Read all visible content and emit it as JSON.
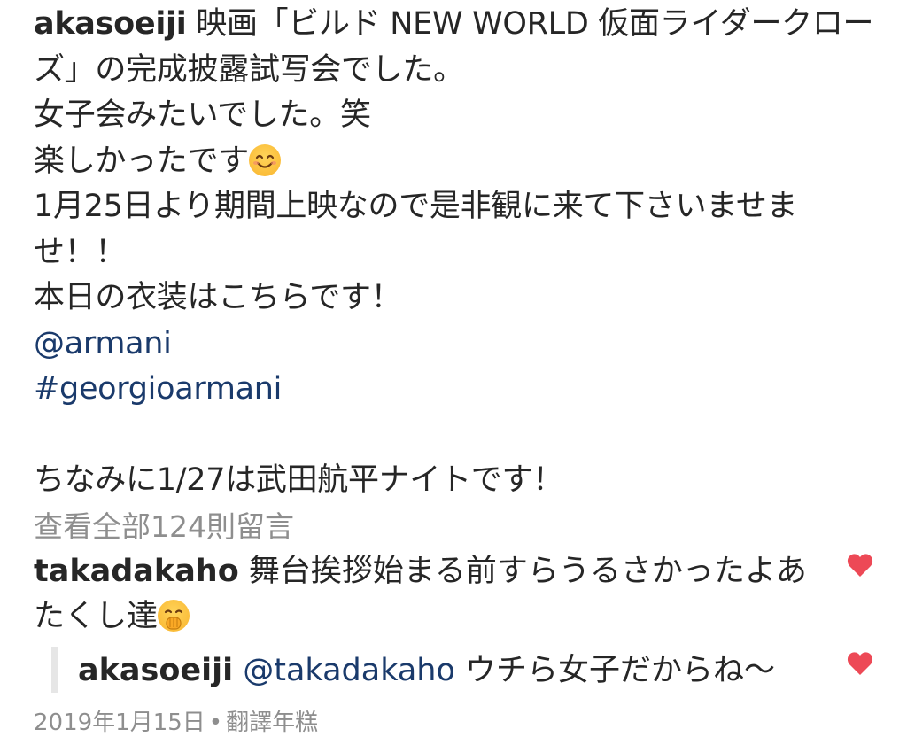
{
  "post": {
    "username": "akasoeiji",
    "caption_lines": [
      "映画「ビルド NEW WORLD 仮面ライダークロー",
      "ズ」の完成披露試写会でした。",
      "女子会みたいでした。笑",
      "楽しかったです",
      "1月25日より期間上映なので是非観に来て下さいませま",
      "せ！！",
      "本日の衣装はこちらです！"
    ],
    "mention": "@armani",
    "hashtag": "#georgioarmani",
    "closing_line": "ちなみに1/27は武田航平ナイトです！",
    "emoji_smile": "smiling-face-emoji"
  },
  "comments": {
    "view_all_label": "查看全部124則留言",
    "items": [
      {
        "username": "takadakaho",
        "text_line1": "舞台挨拶始まる前すらうるさかったよあ",
        "text_line2": "たくし達",
        "emoji": "hand-over-mouth-emoji",
        "like_icon": "heart-icon",
        "like_color": "#ed4956"
      }
    ],
    "reply": {
      "username": "akasoeiji",
      "mention": "@takadakaho",
      "text": "ウチら女子だからね〜",
      "like_icon": "heart-icon",
      "like_color": "#ed4956"
    }
  },
  "footer": {
    "date": "2019年1月15日",
    "separator": "•",
    "translate_label": "翻譯年糕"
  },
  "colors": {
    "text": "#262626",
    "muted": "#8e8e8e",
    "link": "#1a3a6b",
    "heart": "#ed4956"
  }
}
